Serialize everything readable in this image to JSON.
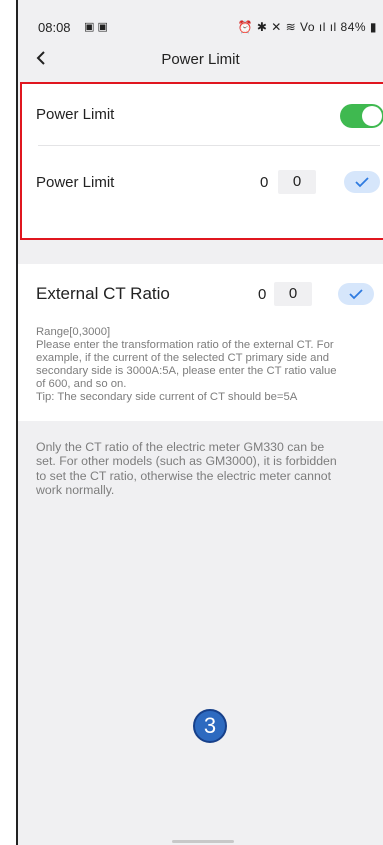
{
  "status_bar": {
    "time": "08:08",
    "left_icons": "▣ ▣",
    "right_text": "⏰ ✱ ✕ ≋ Vo ıl ıl 84%",
    "battery_glyph": "▮"
  },
  "nav": {
    "back_icon": "chevron-left-icon",
    "title": "Power Limit"
  },
  "power_limit_card": {
    "highlight_color": "#e0161f",
    "toggle_row": {
      "label": "Power Limit",
      "enabled": true,
      "toggle_color": "#3fb950"
    },
    "value_row": {
      "label": "Power Limit",
      "current_value": "0",
      "input_value": "0"
    }
  },
  "ct_card": {
    "label": "External CT Ratio",
    "current_value": "0",
    "input_value": "0",
    "range": "Range[0,3000]",
    "help_lines": [
      "Please enter the transformation ratio of the external CT. For",
      "example, if the current of the selected CT primary side and",
      "secondary side is 3000A:5A, please enter the CT ratio value",
      "of 600, and so on."
    ],
    "tip": "Tip: The secondary side current of CT should be=5A"
  },
  "note": {
    "lines": [
      "Only the CT ratio of the electric meter GM330 can be",
      "set. For other models (such as GM3000), it is forbidden",
      "to set the CT ratio, otherwise the electric meter cannot",
      "work normally."
    ]
  },
  "step_marker": "3",
  "colors": {
    "accent_blue": "#2f7be0",
    "confirm_bg": "#d6e6fb",
    "page_bg": "#f0f0f2",
    "marker_bg": "#2d6ac0"
  }
}
